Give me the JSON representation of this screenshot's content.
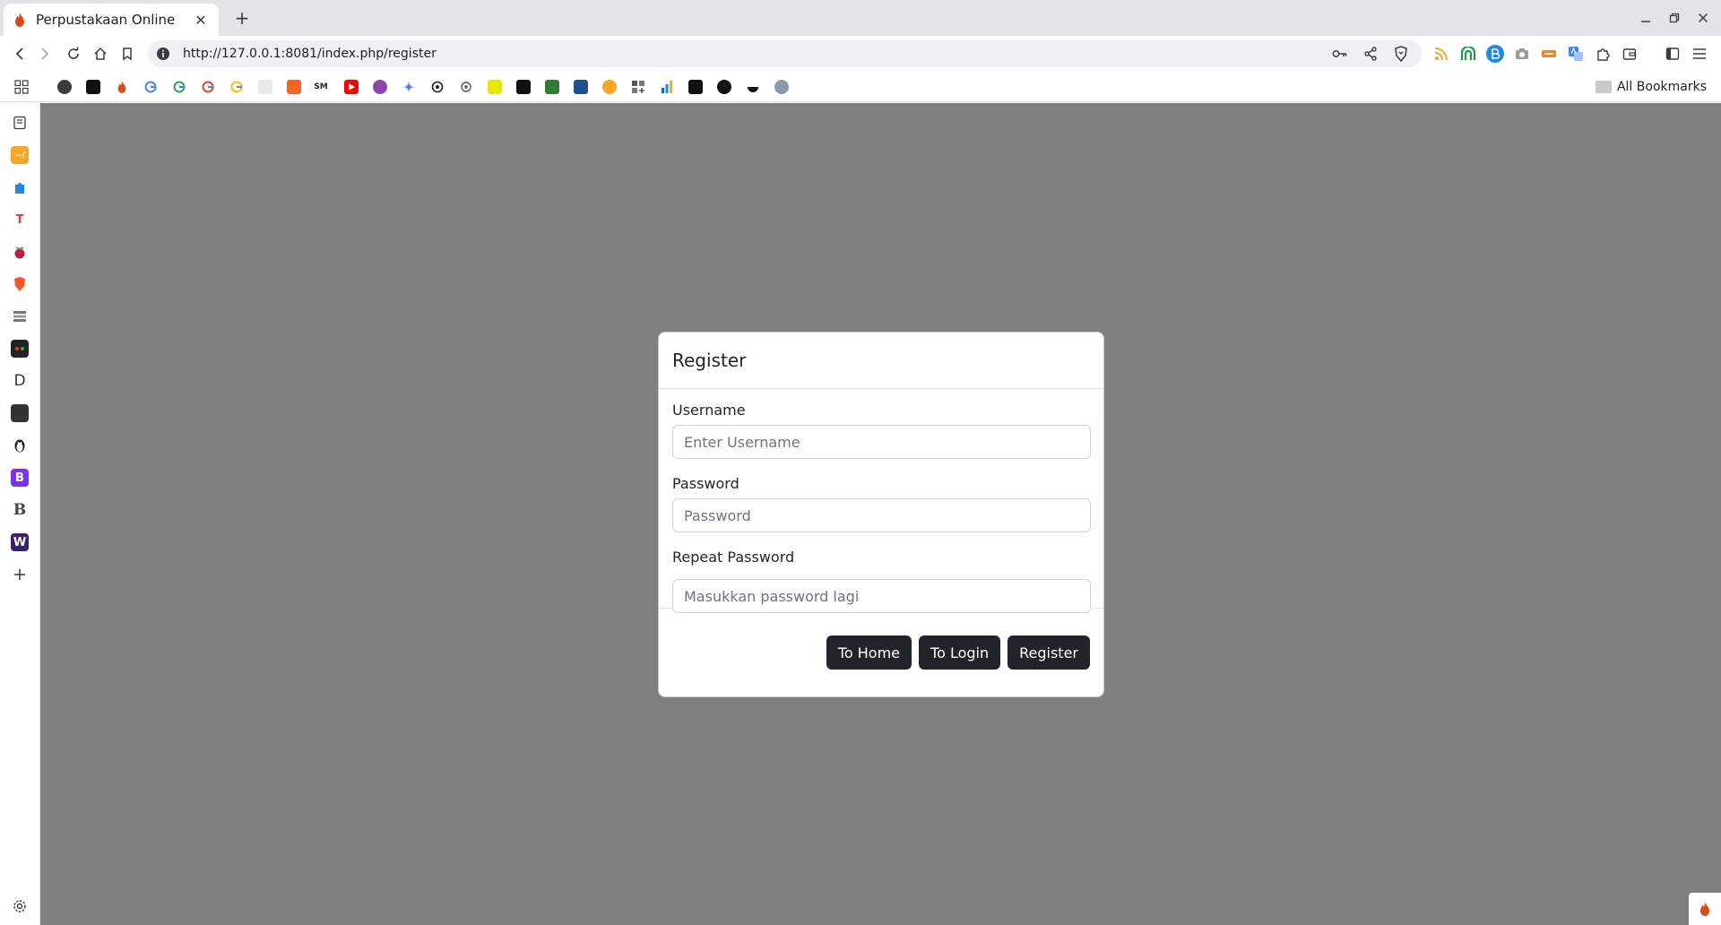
{
  "browser": {
    "tab_title": "Perpustakaan Online",
    "new_tab_symbol": "+",
    "url": "http://127.0.0.1:8081/index.php/register",
    "all_bookmarks_label": "All Bookmarks",
    "accent": "#e3e3e8"
  },
  "modal": {
    "title": "Register",
    "fields": {
      "username": {
        "label": "Username",
        "placeholder": "Enter Username",
        "value": ""
      },
      "password": {
        "label": "Password",
        "placeholder": "Password",
        "value": ""
      },
      "repeat_password": {
        "label": "Repeat Password",
        "placeholder": "Masukkan password lagi",
        "value": ""
      }
    },
    "buttons": {
      "to_home": "To Home",
      "to_login": "To Login",
      "register": "Register"
    },
    "button_color": "#212529",
    "backdrop_color": "#808080"
  },
  "sidebar": {
    "letters": {
      "t": "T",
      "d": "D",
      "b1": "B",
      "b2": "B",
      "w": "W"
    }
  },
  "bookmark_letters": {
    "sm": "SM"
  }
}
